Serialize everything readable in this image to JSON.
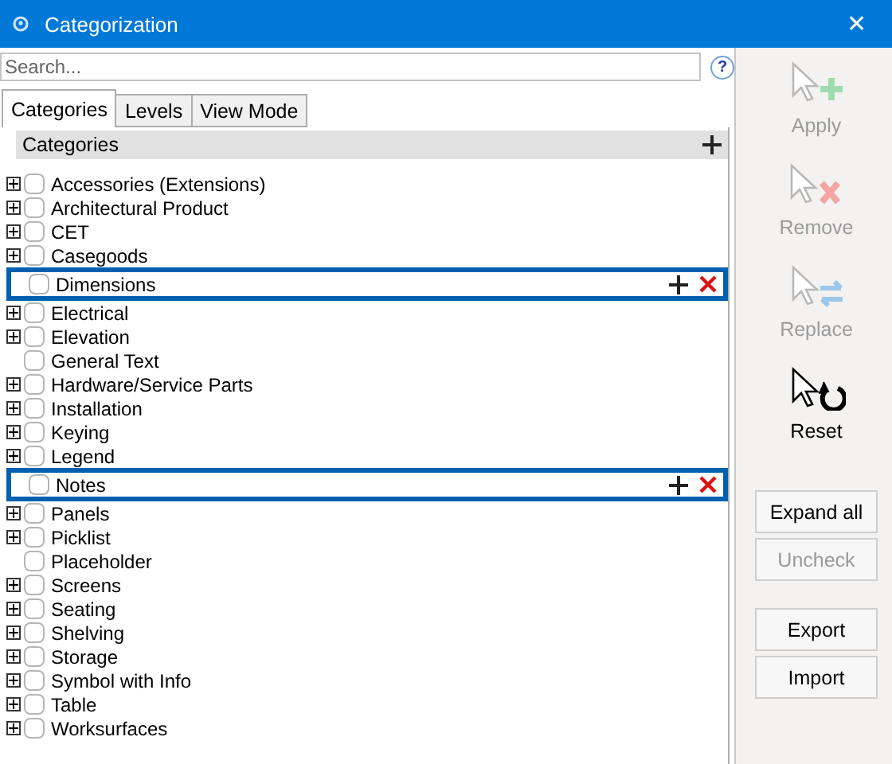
{
  "window": {
    "title": "Categorization",
    "close": "✕"
  },
  "search": {
    "placeholder": "Search...",
    "help": "?"
  },
  "tabs": [
    {
      "label": "Categories",
      "selected": true
    },
    {
      "label": "Levels",
      "selected": false
    },
    {
      "label": "View Mode",
      "selected": false
    }
  ],
  "tree": {
    "header": "Categories",
    "items": [
      {
        "label": "Accessories (Extensions)",
        "expandable": true,
        "checked": false,
        "highlighted": false
      },
      {
        "label": "Architectural Product",
        "expandable": true,
        "checked": false,
        "highlighted": false
      },
      {
        "label": "CET",
        "expandable": true,
        "checked": false,
        "highlighted": false
      },
      {
        "label": "Casegoods",
        "expandable": true,
        "checked": false,
        "highlighted": false
      },
      {
        "label": "Dimensions",
        "expandable": false,
        "checked": false,
        "highlighted": true
      },
      {
        "label": "Electrical",
        "expandable": true,
        "checked": false,
        "highlighted": false
      },
      {
        "label": "Elevation",
        "expandable": true,
        "checked": false,
        "highlighted": false
      },
      {
        "label": "General Text",
        "expandable": false,
        "checked": false,
        "highlighted": false
      },
      {
        "label": "Hardware/Service Parts",
        "expandable": true,
        "checked": false,
        "highlighted": false
      },
      {
        "label": "Installation",
        "expandable": true,
        "checked": false,
        "highlighted": false
      },
      {
        "label": "Keying",
        "expandable": true,
        "checked": false,
        "highlighted": false
      },
      {
        "label": "Legend",
        "expandable": true,
        "checked": false,
        "highlighted": false
      },
      {
        "label": "Notes",
        "expandable": false,
        "checked": false,
        "highlighted": true
      },
      {
        "label": "Panels",
        "expandable": true,
        "checked": false,
        "highlighted": false
      },
      {
        "label": "Picklist",
        "expandable": true,
        "checked": false,
        "highlighted": false
      },
      {
        "label": "Placeholder",
        "expandable": false,
        "checked": false,
        "highlighted": false
      },
      {
        "label": "Screens",
        "expandable": true,
        "checked": false,
        "highlighted": false
      },
      {
        "label": "Seating",
        "expandable": true,
        "checked": false,
        "highlighted": false
      },
      {
        "label": "Shelving",
        "expandable": true,
        "checked": false,
        "highlighted": false
      },
      {
        "label": "Storage",
        "expandable": true,
        "checked": false,
        "highlighted": false
      },
      {
        "label": "Symbol with Info",
        "expandable": true,
        "checked": false,
        "highlighted": false
      },
      {
        "label": "Table",
        "expandable": true,
        "checked": false,
        "highlighted": false
      },
      {
        "label": "Worksurfaces",
        "expandable": true,
        "checked": false,
        "highlighted": false
      }
    ]
  },
  "actions": [
    {
      "kind": "apply",
      "label": "Apply",
      "disabled": true
    },
    {
      "kind": "remove",
      "label": "Remove",
      "disabled": true
    },
    {
      "kind": "replace",
      "label": "Replace",
      "disabled": true
    },
    {
      "kind": "reset",
      "label": "Reset",
      "disabled": false
    }
  ],
  "button_groups": [
    [
      {
        "label": "Expand all",
        "disabled": false
      },
      {
        "label": "Uncheck",
        "disabled": true
      }
    ],
    [
      {
        "label": "Export",
        "disabled": false
      },
      {
        "label": "Import",
        "disabled": false
      }
    ]
  ]
}
